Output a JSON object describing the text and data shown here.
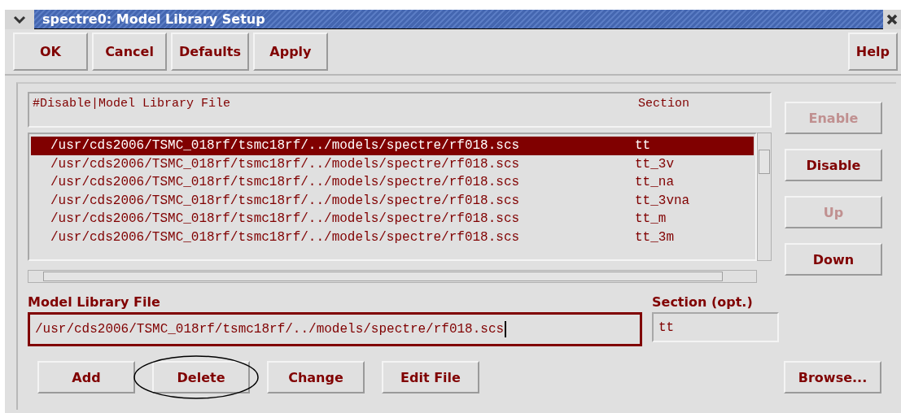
{
  "window": {
    "title": "spectre0: Model Library Setup"
  },
  "toolbar": [
    {
      "label": "OK"
    },
    {
      "label": "Cancel"
    },
    {
      "label": "Defaults"
    },
    {
      "label": "Apply"
    }
  ],
  "help": {
    "label": "Help"
  },
  "list": {
    "columns": [
      "#Disable|Model Library File",
      "Section"
    ],
    "rows": [
      {
        "file": "/usr/cds2006/TSMC_018rf/tsmc18rf/../models/spectre/rf018.scs",
        "section": "tt",
        "selected": true
      },
      {
        "file": "/usr/cds2006/TSMC_018rf/tsmc18rf/../models/spectre/rf018.scs",
        "section": "tt_3v",
        "selected": false
      },
      {
        "file": "/usr/cds2006/TSMC_018rf/tsmc18rf/../models/spectre/rf018.scs",
        "section": "tt_na",
        "selected": false
      },
      {
        "file": "/usr/cds2006/TSMC_018rf/tsmc18rf/../models/spectre/rf018.scs",
        "section": "tt_3vna",
        "selected": false
      },
      {
        "file": "/usr/cds2006/TSMC_018rf/tsmc18rf/../models/spectre/rf018.scs",
        "section": "tt_m",
        "selected": false
      },
      {
        "file": "/usr/cds2006/TSMC_018rf/tsmc18rf/../models/spectre/rf018.scs",
        "section": "tt_3m",
        "selected": false
      }
    ]
  },
  "side_buttons": [
    {
      "label": "Enable",
      "disabled": true
    },
    {
      "label": "Disable",
      "disabled": false
    },
    {
      "label": "Up",
      "disabled": true
    },
    {
      "label": "Down",
      "disabled": false
    }
  ],
  "file_field": {
    "label": "Model Library File",
    "value": "/usr/cds2006/TSMC_018rf/tsmc18rf/../models/spectre/rf018.scs"
  },
  "section_field": {
    "label": "Section (opt.)",
    "value": "tt"
  },
  "bottom_buttons": [
    {
      "label": "Add",
      "circled": false
    },
    {
      "label": "Delete",
      "circled": true
    },
    {
      "label": "Change",
      "circled": false
    },
    {
      "label": "Edit File",
      "circled": false
    }
  ],
  "browse": {
    "label": "Browse..."
  }
}
